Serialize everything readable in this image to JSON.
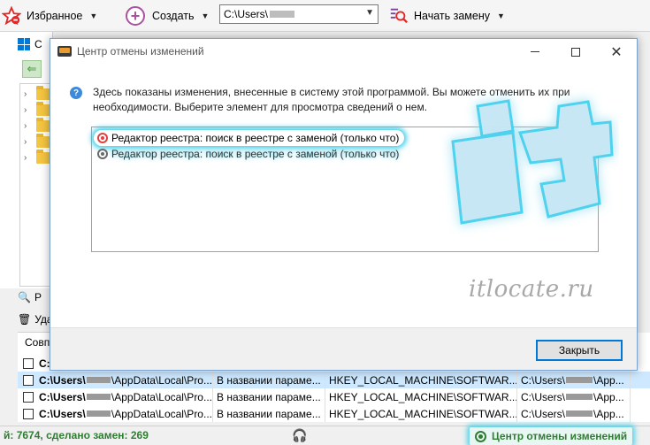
{
  "toolbar": {
    "favorites_label": "Избранное",
    "create_label": "Создать",
    "path_prefix": "C:\\Users\\",
    "start_replace_label": "Начать замену",
    "arrow": "▼"
  },
  "left_panel": {
    "header_label": "С",
    "back_glyph": "⇐",
    "tree_items": 5,
    "search_label": "Р",
    "delete_label": "Уда"
  },
  "table": {
    "header_label": "Совп",
    "rows": [
      {
        "col1_prefix": "C:\\Users\\",
        "col1_suffix": "",
        "col2": "",
        "col3": "",
        "col4": "",
        "selected": false,
        "header_like": true
      },
      {
        "col1_prefix": "C:\\Users\\",
        "col1_suffix": "\\AppData\\Local\\Pro...",
        "col2": "В названии параме...",
        "col3": "HKEY_LOCAL_MACHINE\\SOFTWAR...",
        "col4_prefix": "C:\\Users\\",
        "col4_suffix": "\\App...",
        "selected": true
      },
      {
        "col1_prefix": "C:\\Users\\",
        "col1_suffix": "\\AppData\\Local\\Pro...",
        "col2": "В названии параме...",
        "col3": "HKEY_LOCAL_MACHINE\\SOFTWAR...",
        "col4_prefix": "C:\\Users\\",
        "col4_suffix": "\\App...",
        "selected": false
      },
      {
        "col1_prefix": "C:\\Users\\",
        "col1_suffix": "\\AppData\\Local\\Pro...",
        "col2": "В названии параме...",
        "col3": "HKEY_LOCAL_MACHINE\\SOFTWAR...",
        "col4_prefix": "C:\\Users\\",
        "col4_suffix": "\\App...",
        "selected": false
      }
    ]
  },
  "status": {
    "left_text": "й: 7674, сделано замен: 269",
    "right_text": "Центр отмены изменений"
  },
  "dialog": {
    "title": "Центр отмены изменений",
    "info_text": "Здесь показаны изменения, внесенные в систему этой программой. Вы можете отменить их при необходимости. Выберите элемент для просмотра сведений о нем.",
    "items": [
      "Редактор реестра: поиск в реестре с заменой (только что)",
      "Редактор реестра: поиск в реестре с заменой (только что)"
    ],
    "close_label": "Закрыть",
    "close_glyph": "✕"
  },
  "watermark": {
    "text": "itlocate.ru"
  },
  "colors": {
    "accent_glow": "#28c8e6",
    "status_green": "#2f7d32",
    "favorites_star": "#e02828",
    "create_plus": "#a9539e"
  }
}
